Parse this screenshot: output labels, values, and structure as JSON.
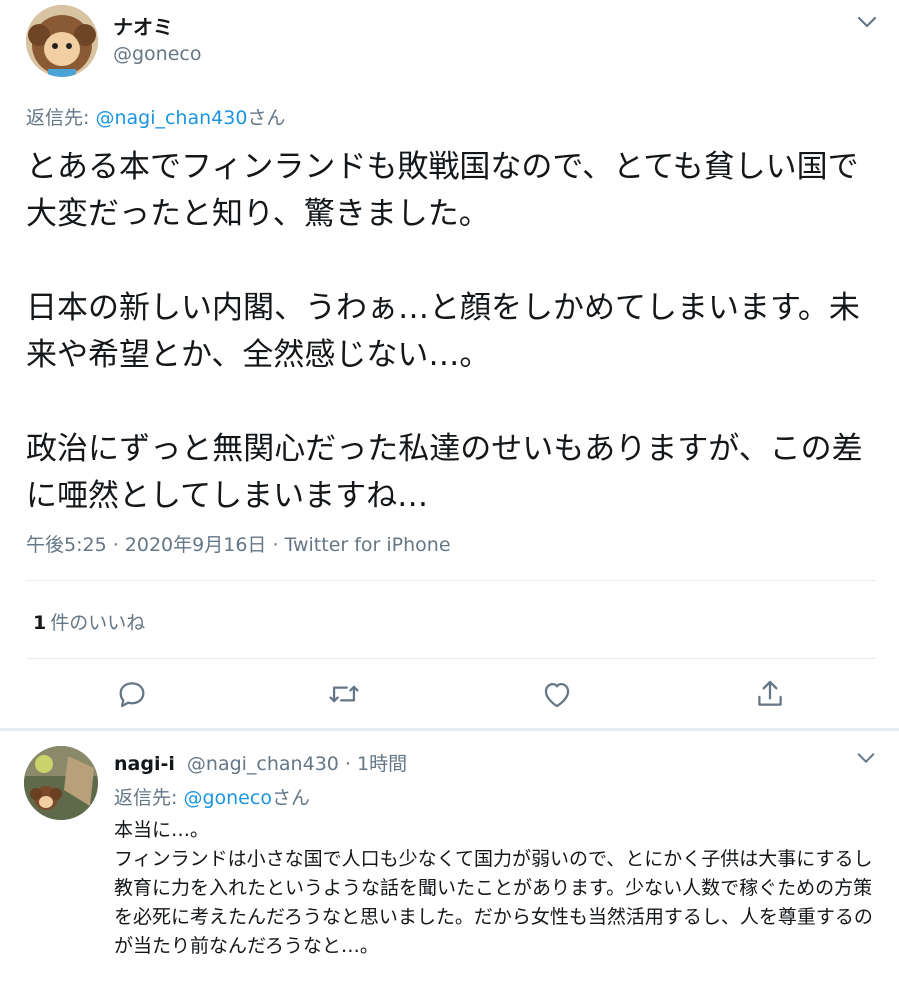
{
  "main_tweet": {
    "display_name": "ナオミ",
    "handle": "@goneco",
    "reply_to_prefix": "返信先: ",
    "reply_to_handle": "@nagi_chan430",
    "reply_to_suffix": "さん",
    "text": "とある本でフィンランドも敗戦国なので、とても貧しい国で大変だったと知り、驚きました。\n\n日本の新しい内閣、うわぁ…と顔をしかめてしまいます。未来や希望とか、全然感じない…。\n\n政治にずっと無関心だった私達のせいもありますが、この差に唖然としてしまいますね…",
    "timestamp": "午後5:25 · 2020年9月16日 · Twitter for iPhone",
    "like_count": "1",
    "like_label": "件のいいね",
    "actions": [
      "reply-icon",
      "retweet-icon",
      "like-icon",
      "share-icon"
    ]
  },
  "reply_tweet": {
    "display_name": "nagi-i",
    "handle": "@nagi_chan430",
    "separator": "·",
    "time": "1時間",
    "reply_to_prefix": "返信先: ",
    "reply_to_handle": "@goneco",
    "reply_to_suffix": "さん",
    "text": "本当に…。\nフィンランドは小さな国で人口も少なくて国力が弱いので、とにかく子供は大事にするし教育に力を入れたというような話を聞いたことがあります。少ない人数で稼ぐための方策を必死に考えたんだろうなと思いました。だから女性も当然活用するし、人を尊重するのが当たり前なんだろうなと…。"
  },
  "colors": {
    "text": "#14171a",
    "secondary": "#657786",
    "link": "#1b95e0",
    "divider": "#e6ecf0"
  }
}
